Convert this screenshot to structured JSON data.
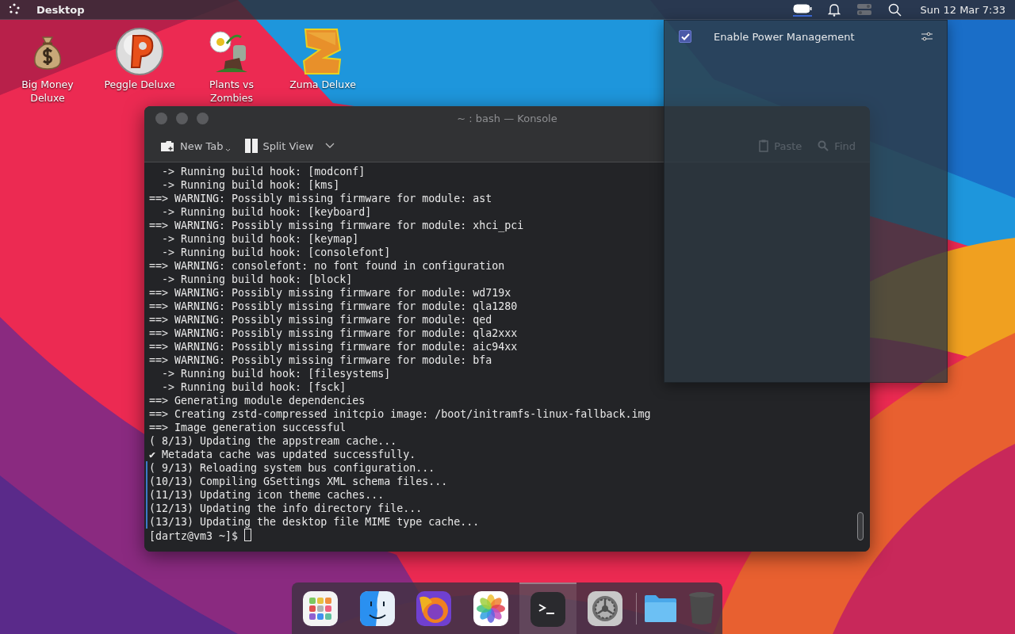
{
  "top_bar": {
    "title": "Desktop",
    "clock": "Sun 12 Mar 7:33"
  },
  "desktop_icons": [
    {
      "label": "Big Money Deluxe"
    },
    {
      "label": "Peggle Deluxe"
    },
    {
      "label": "Plants vs Zombies"
    },
    {
      "label": "Zuma Deluxe"
    }
  ],
  "konsole": {
    "title": "~ : bash — Konsole",
    "toolbar": [
      {
        "label": "New Tab"
      },
      {
        "label": "Split View"
      }
    ],
    "dimmed_toolbar": [
      {
        "label": "Paste"
      },
      {
        "label": "Find"
      }
    ],
    "lines": [
      {
        "text": "  -> Running build hook: [modconf]",
        "marked": false
      },
      {
        "text": "  -> Running build hook: [kms]",
        "marked": false
      },
      {
        "text": "==> WARNING: Possibly missing firmware for module: ast",
        "marked": false
      },
      {
        "text": "  -> Running build hook: [keyboard]",
        "marked": false
      },
      {
        "text": "==> WARNING: Possibly missing firmware for module: xhci_pci",
        "marked": false
      },
      {
        "text": "  -> Running build hook: [keymap]",
        "marked": false
      },
      {
        "text": "  -> Running build hook: [consolefont]",
        "marked": false
      },
      {
        "text": "==> WARNING: consolefont: no font found in configuration",
        "marked": false
      },
      {
        "text": "  -> Running build hook: [block]",
        "marked": false
      },
      {
        "text": "==> WARNING: Possibly missing firmware for module: wd719x",
        "marked": false
      },
      {
        "text": "==> WARNING: Possibly missing firmware for module: qla1280",
        "marked": false
      },
      {
        "text": "==> WARNING: Possibly missing firmware for module: qed",
        "marked": false
      },
      {
        "text": "==> WARNING: Possibly missing firmware for module: qla2xxx",
        "marked": false
      },
      {
        "text": "==> WARNING: Possibly missing firmware for module: aic94xx",
        "marked": false
      },
      {
        "text": "==> WARNING: Possibly missing firmware for module: bfa",
        "marked": false
      },
      {
        "text": "  -> Running build hook: [filesystems]",
        "marked": false
      },
      {
        "text": "  -> Running build hook: [fsck]",
        "marked": false
      },
      {
        "text": "==> Generating module dependencies",
        "marked": false
      },
      {
        "text": "==> Creating zstd-compressed initcpio image: /boot/initramfs-linux-fallback.img",
        "marked": false
      },
      {
        "text": "==> Image generation successful",
        "marked": false
      },
      {
        "text": "( 8/13) Updating the appstream cache...",
        "marked": false
      },
      {
        "text": "✔ Metadata cache was updated successfully.",
        "marked": false
      },
      {
        "text": "( 9/13) Reloading system bus configuration...",
        "marked": true
      },
      {
        "text": "(10/13) Compiling GSettings XML schema files...",
        "marked": true
      },
      {
        "text": "(11/13) Updating icon theme caches...",
        "marked": true
      },
      {
        "text": "(12/13) Updating the info directory file...",
        "marked": true
      },
      {
        "text": "(13/13) Updating the desktop file MIME type cache...",
        "marked": true
      }
    ],
    "prompt": "[dartz@vm3 ~]$ "
  },
  "power_popup": {
    "label": "Enable Power Management",
    "checked": true
  },
  "dock": {
    "items": [
      {
        "active": false
      },
      {
        "active": false
      },
      {
        "active": false
      },
      {
        "active": false
      },
      {
        "active": true
      },
      {
        "active": false
      },
      {
        "active": false
      },
      {
        "active": false
      }
    ]
  }
}
